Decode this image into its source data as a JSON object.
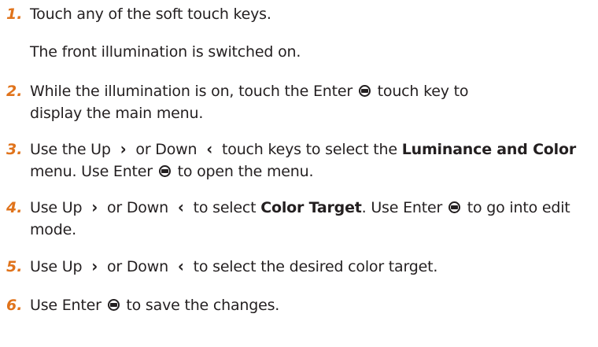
{
  "steps": [
    {
      "number": "1.",
      "text": "Touch any of the soft touch keys.",
      "result": "The front illumination is switched on."
    },
    {
      "number": "2.",
      "part1": "While the illumination is on, touch the Enter",
      "part2": "touch key to display the main menu."
    },
    {
      "number": "3.",
      "part1": "Use the Up",
      "part2": "or Down",
      "part3": "touch keys to select the",
      "bold1": "Luminance and Color",
      "part4": "menu. Use Enter",
      "part5": "to open the menu."
    },
    {
      "number": "4.",
      "part1": "Use Up",
      "part2": "or Down",
      "part3": "to select",
      "bold1": "Color Target",
      "part4": ". Use Enter",
      "part5": "to go into edit mode."
    },
    {
      "number": "5.",
      "part1": "Use Up",
      "part2": "or Down",
      "part3": "to select the desired color target."
    },
    {
      "number": "6.",
      "part1": "Use Enter",
      "part2": "to save the changes."
    }
  ],
  "icons": {
    "up": "›",
    "down": "‹",
    "enter": "enter-key-icon"
  },
  "colors": {
    "step_number": "#e0731b",
    "text": "#231f20"
  }
}
